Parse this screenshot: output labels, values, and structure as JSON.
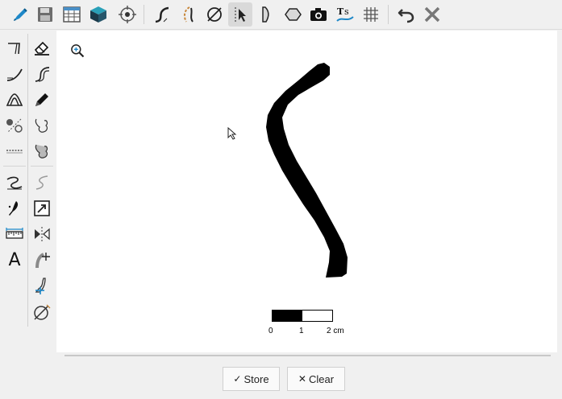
{
  "toolbar": {
    "icons": [
      "pen-icon",
      "save-icon",
      "table-icon",
      "3d-box-icon",
      "target-icon",
      "curve-icon",
      "rotate-curve-icon",
      "diameter-icon",
      "tracing-cursor-icon",
      "blade-icon",
      "polygon-icon",
      "camera-icon",
      "text-path-icon",
      "grid-icon",
      "undo-icon",
      "close-icon"
    ]
  },
  "left_tools": {
    "column1": [
      "corner-line-icon",
      "arc-line-icon",
      "triangle-shape-icon",
      "points-line-icon",
      "dashed-line-icon",
      "s-curve-icon",
      "brush-stroke-icon",
      "ruler-icon",
      "text-tool-icon"
    ],
    "column2": [
      "eraser-icon",
      "offset-curve-icon",
      "pencil-icon",
      "shape-outline-icon",
      "fill-shape-icon",
      "s-curve-grey-icon",
      "resize-icon",
      "mirror-icon",
      "profile-add-icon",
      "profile-edit-icon",
      "diameter-icon"
    ],
    "text_tool_glyph": "A"
  },
  "scale": {
    "label_0": "0",
    "label_1": "1",
    "label_2": "2 cm"
  },
  "buttons": {
    "store_icon": "✓",
    "store_label": "Store",
    "clear_icon": "✕",
    "clear_label": "Clear"
  },
  "colors": {
    "toolbar_bg": "#f0f0f0",
    "canvas_bg": "#ffffff",
    "accent_blue": "#1e88c8",
    "icon_dark": "#222222"
  }
}
